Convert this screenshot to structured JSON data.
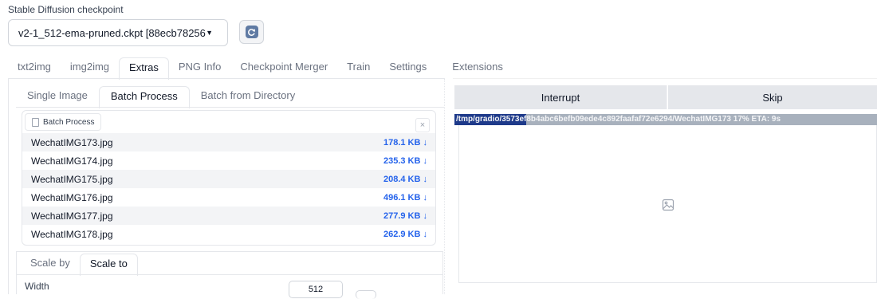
{
  "checkpoint": {
    "label": "Stable Diffusion checkpoint",
    "value": "v2-1_512-ema-pruned.ckpt [88ecb78256]",
    "refresh_icon": "refresh-icon"
  },
  "main_tabs": [
    {
      "label": "txt2img",
      "active": false
    },
    {
      "label": "img2img",
      "active": false
    },
    {
      "label": "Extras",
      "active": true
    },
    {
      "label": "PNG Info",
      "active": false
    },
    {
      "label": "Checkpoint Merger",
      "active": false
    },
    {
      "label": "Train",
      "active": false
    },
    {
      "label": "Settings",
      "active": false
    },
    {
      "label": "Extensions",
      "active": false
    }
  ],
  "sub_tabs": [
    {
      "label": "Single Image",
      "active": false
    },
    {
      "label": "Batch Process",
      "active": true
    },
    {
      "label": "Batch from Directory",
      "active": false
    }
  ],
  "batch": {
    "chip_label": "Batch Process",
    "close_symbol": "×",
    "files": [
      {
        "name": "WechatIMG173.jpg",
        "size": "178.1 KB ↓"
      },
      {
        "name": "WechatIMG174.jpg",
        "size": "235.3 KB ↓"
      },
      {
        "name": "WechatIMG175.jpg",
        "size": "208.4 KB ↓"
      },
      {
        "name": "WechatIMG176.jpg",
        "size": "496.1 KB ↓"
      },
      {
        "name": "WechatIMG177.jpg",
        "size": "277.9 KB ↓"
      },
      {
        "name": "WechatIMG178.jpg",
        "size": "262.9 KB ↓"
      }
    ]
  },
  "scale_tabs": [
    {
      "label": "Scale by",
      "active": false
    },
    {
      "label": "Scale to",
      "active": true
    }
  ],
  "width": {
    "label": "Width",
    "value": "512"
  },
  "actions": {
    "interrupt": "Interrupt",
    "skip": "Skip"
  },
  "progress": {
    "text": "/tmp/gradio/3573ef8b4abc6befb09ede4c892faafaf72e6294/WechatIMG173 17% ETA: 9s",
    "percent": 17
  },
  "output": {
    "placeholder_icon": "image-icon"
  },
  "colors": {
    "accent": "#2563eb",
    "progress_fill": "#1e3a8a",
    "progress_track": "#a8b1bd"
  }
}
